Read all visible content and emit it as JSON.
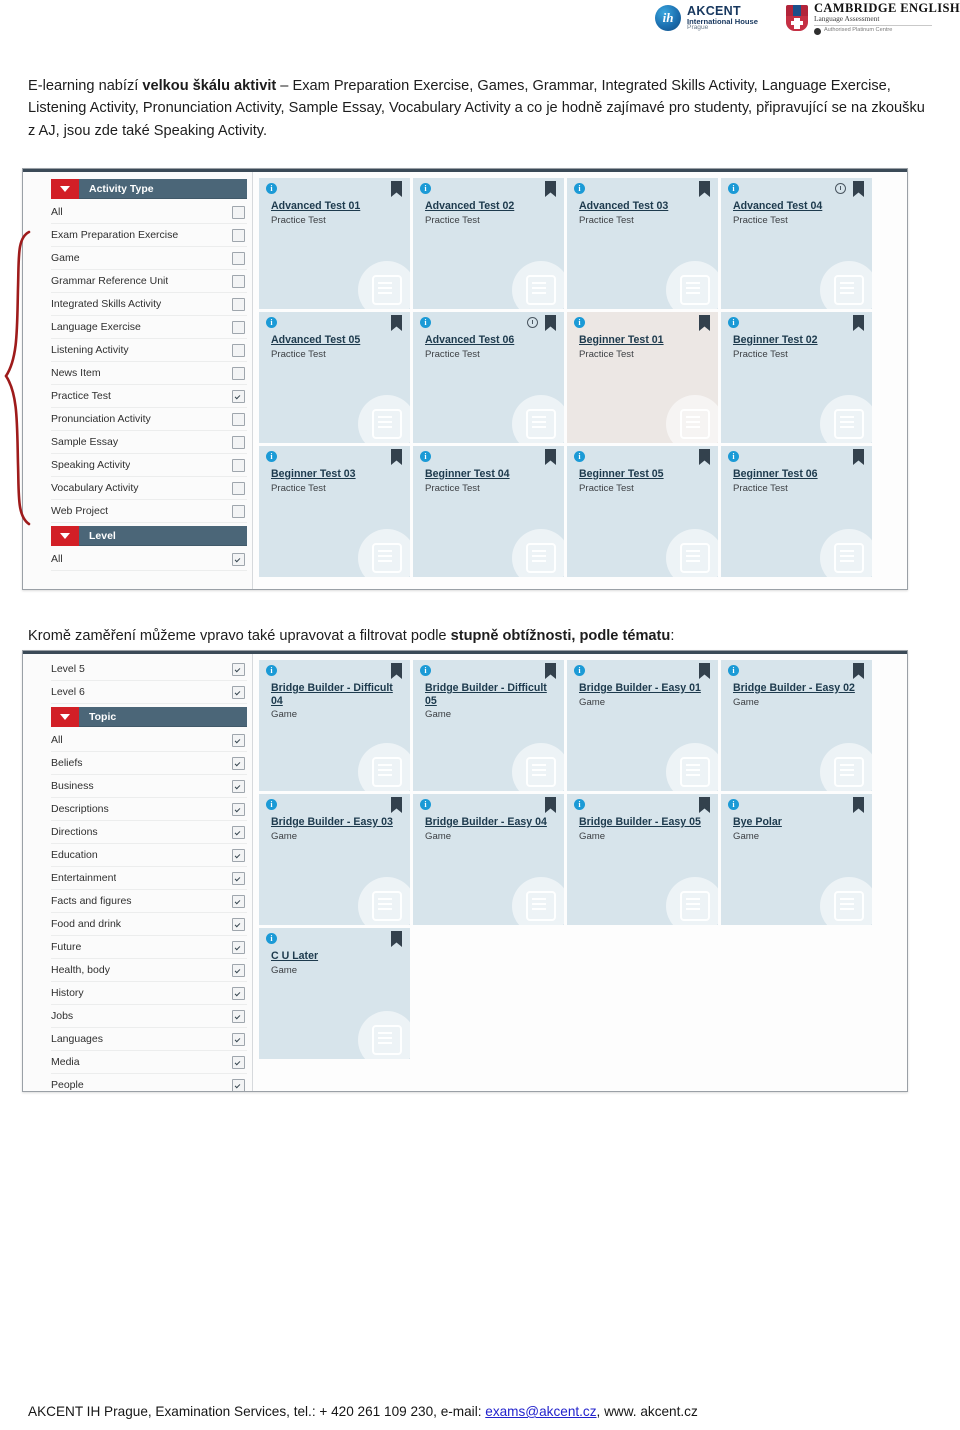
{
  "header": {
    "akcent": {
      "name": "AKCENT",
      "sub": "International House",
      "city": "Prague",
      "monogram": "ih"
    },
    "cambridge": {
      "name": "CAMBRIDGE ENGLISH",
      "sub": "Language Assessment",
      "auth": "Authorised Platinum Centre"
    }
  },
  "intro_paragraph": {
    "part1": "E-learning nabízí ",
    "bold1": "velkou škálu  aktivit",
    "part2": " – Exam Preparation Exercise, Games, Grammar, Integrated Skills Activity, Language Exercise, Listening Activity, Pronunciation Activity, Sample Essay, Vocabulary Activity a co je hodně zajímavé pro studenty, připravující se na zkoušku z AJ, jsou zde také Speaking Activity."
  },
  "mid_paragraph": {
    "part1": "Kromě zaměření můžeme vpravo také upravovat a filtrovat podle ",
    "bold1": "stupně obtížnosti, podle tématu",
    "part2": ":"
  },
  "screenshot1": {
    "filters": [
      {
        "type": "group",
        "label": "Activity Type"
      },
      {
        "type": "row",
        "label": "All",
        "checked": false
      },
      {
        "type": "row",
        "label": "Exam Preparation Exercise",
        "checked": false
      },
      {
        "type": "row",
        "label": "Game",
        "checked": false
      },
      {
        "type": "row",
        "label": "Grammar Reference Unit",
        "checked": false
      },
      {
        "type": "row",
        "label": "Integrated Skills Activity",
        "checked": false
      },
      {
        "type": "row",
        "label": "Language Exercise",
        "checked": false
      },
      {
        "type": "row",
        "label": "Listening Activity",
        "checked": false
      },
      {
        "type": "row",
        "label": "News Item",
        "checked": false
      },
      {
        "type": "row",
        "label": "Practice Test",
        "checked": true
      },
      {
        "type": "row",
        "label": "Pronunciation Activity",
        "checked": false
      },
      {
        "type": "row",
        "label": "Sample Essay",
        "checked": false
      },
      {
        "type": "row",
        "label": "Speaking Activity",
        "checked": false
      },
      {
        "type": "row",
        "label": "Vocabulary Activity",
        "checked": false
      },
      {
        "type": "row",
        "label": "Web Project",
        "checked": false
      },
      {
        "type": "group",
        "label": "Level"
      },
      {
        "type": "row",
        "label": "All",
        "checked": true
      }
    ],
    "cards": [
      {
        "title": "Advanced Test 01",
        "subtitle": "Practice Test",
        "history": false,
        "alt": false
      },
      {
        "title": "Advanced Test 02",
        "subtitle": "Practice Test",
        "history": false,
        "alt": false
      },
      {
        "title": "Advanced Test 03",
        "subtitle": "Practice Test",
        "history": false,
        "alt": false
      },
      {
        "title": "Advanced Test 04",
        "subtitle": "Practice Test",
        "history": true,
        "alt": false
      },
      {
        "title": "Advanced Test 05",
        "subtitle": "Practice Test",
        "history": false,
        "alt": false
      },
      {
        "title": "Advanced Test 06",
        "subtitle": "Practice Test",
        "history": true,
        "alt": false
      },
      {
        "title": "Beginner Test 01",
        "subtitle": "Practice Test",
        "history": false,
        "alt": true
      },
      {
        "title": "Beginner Test 02",
        "subtitle": "Practice Test",
        "history": false,
        "alt": false
      },
      {
        "title": "Beginner Test 03",
        "subtitle": "Practice Test",
        "history": false,
        "alt": false
      },
      {
        "title": "Beginner Test 04",
        "subtitle": "Practice Test",
        "history": false,
        "alt": false
      },
      {
        "title": "Beginner Test 05",
        "subtitle": "Practice Test",
        "history": false,
        "alt": false
      },
      {
        "title": "Beginner Test 06",
        "subtitle": "Practice Test",
        "history": false,
        "alt": false
      }
    ]
  },
  "screenshot2": {
    "filters": [
      {
        "type": "row",
        "label": "Level 5",
        "checked": true
      },
      {
        "type": "row",
        "label": "Level 6",
        "checked": true
      },
      {
        "type": "group",
        "label": "Topic"
      },
      {
        "type": "row",
        "label": "All",
        "checked": true
      },
      {
        "type": "row",
        "label": "Beliefs",
        "checked": true
      },
      {
        "type": "row",
        "label": "Business",
        "checked": true
      },
      {
        "type": "row",
        "label": "Descriptions",
        "checked": true
      },
      {
        "type": "row",
        "label": "Directions",
        "checked": true
      },
      {
        "type": "row",
        "label": "Education",
        "checked": true
      },
      {
        "type": "row",
        "label": "Entertainment",
        "checked": true
      },
      {
        "type": "row",
        "label": "Facts and figures",
        "checked": true
      },
      {
        "type": "row",
        "label": "Food and drink",
        "checked": true
      },
      {
        "type": "row",
        "label": "Future",
        "checked": true
      },
      {
        "type": "row",
        "label": "Health, body",
        "checked": true
      },
      {
        "type": "row",
        "label": "History",
        "checked": true
      },
      {
        "type": "row",
        "label": "Jobs",
        "checked": true
      },
      {
        "type": "row",
        "label": "Languages",
        "checked": true
      },
      {
        "type": "row",
        "label": "Media",
        "checked": true
      },
      {
        "type": "row",
        "label": "People",
        "checked": true
      }
    ],
    "cards": [
      {
        "title": "Bridge Builder - Difficult 04",
        "subtitle": "Game",
        "history": false,
        "alt": false
      },
      {
        "title": "Bridge Builder - Difficult 05",
        "subtitle": "Game",
        "history": false,
        "alt": false
      },
      {
        "title": "Bridge Builder - Easy 01",
        "subtitle": "Game",
        "history": false,
        "alt": false
      },
      {
        "title": "Bridge Builder - Easy 02",
        "subtitle": "Game",
        "history": false,
        "alt": false
      },
      {
        "title": "Bridge Builder - Easy 03",
        "subtitle": "Game",
        "history": false,
        "alt": false
      },
      {
        "title": "Bridge Builder - Easy 04",
        "subtitle": "Game",
        "history": false,
        "alt": false
      },
      {
        "title": "Bridge Builder - Easy 05",
        "subtitle": "Game",
        "history": false,
        "alt": false
      },
      {
        "title": "Bye Polar",
        "subtitle": "Game",
        "history": false,
        "alt": false
      },
      {
        "title": "C U Later",
        "subtitle": "Game",
        "history": false,
        "alt": false
      }
    ]
  },
  "footer": {
    "part1": "AKCENT IH Prague, Examination Services, tel.: + 420 261 109 230, e-mail: ",
    "email": "exams@akcent.cz",
    "part2": ", www. akcent.cz"
  },
  "colors": {
    "accent_red": "#d21f26",
    "group_header": "#4b6678",
    "card_bg": "#d7e4eb",
    "card_bg_alt": "#ece7e4",
    "info_blue": "#1b9ad6",
    "link_blue": "#2222cc",
    "brace_red": "#9e1b1b"
  }
}
